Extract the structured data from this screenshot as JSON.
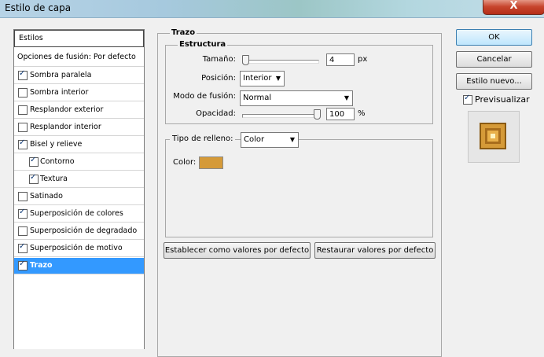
{
  "window": {
    "title": "Estilo de capa",
    "close_glyph": "X"
  },
  "styles_list": {
    "header": "Estilos",
    "blend_options": "Opciones de fusión: Por defecto",
    "items": [
      {
        "label": "Sombra paralela",
        "checked": true
      },
      {
        "label": "Sombra interior",
        "checked": false
      },
      {
        "label": "Resplandor exterior",
        "checked": false
      },
      {
        "label": "Resplandor interior",
        "checked": false
      },
      {
        "label": "Bisel y relieve",
        "checked": true
      },
      {
        "label": "Contorno",
        "checked": true
      },
      {
        "label": "Textura",
        "checked": true
      },
      {
        "label": "Satinado",
        "checked": false
      },
      {
        "label": "Superposición de colores",
        "checked": true
      },
      {
        "label": "Superposición de degradado",
        "checked": false
      },
      {
        "label": "Superposición de motivo",
        "checked": true
      },
      {
        "label": "Trazo",
        "checked": true,
        "selected": true
      }
    ]
  },
  "trazo": {
    "title": "Trazo",
    "estructura": {
      "title": "Estructura",
      "size_label": "Tamaño:",
      "size_value": "4",
      "size_unit": "px",
      "position_label": "Posición:",
      "position_value": "Interior",
      "blend_label": "Modo de fusión:",
      "blend_value": "Normal",
      "opacity_label": "Opacidad:",
      "opacity_value": "100",
      "opacity_unit": "%"
    },
    "fill": {
      "type_label": "Tipo de relleno:",
      "type_value": "Color",
      "color_label": "Color:",
      "color": "#d59a38"
    },
    "set_default": "Establecer como valores por defecto",
    "reset_default": "Restaurar valores por defecto"
  },
  "actions": {
    "ok": "OK",
    "cancel": "Cancelar",
    "new_style": "Estilo nuevo...",
    "preview_label": "Previsualizar",
    "preview_checked": true
  }
}
